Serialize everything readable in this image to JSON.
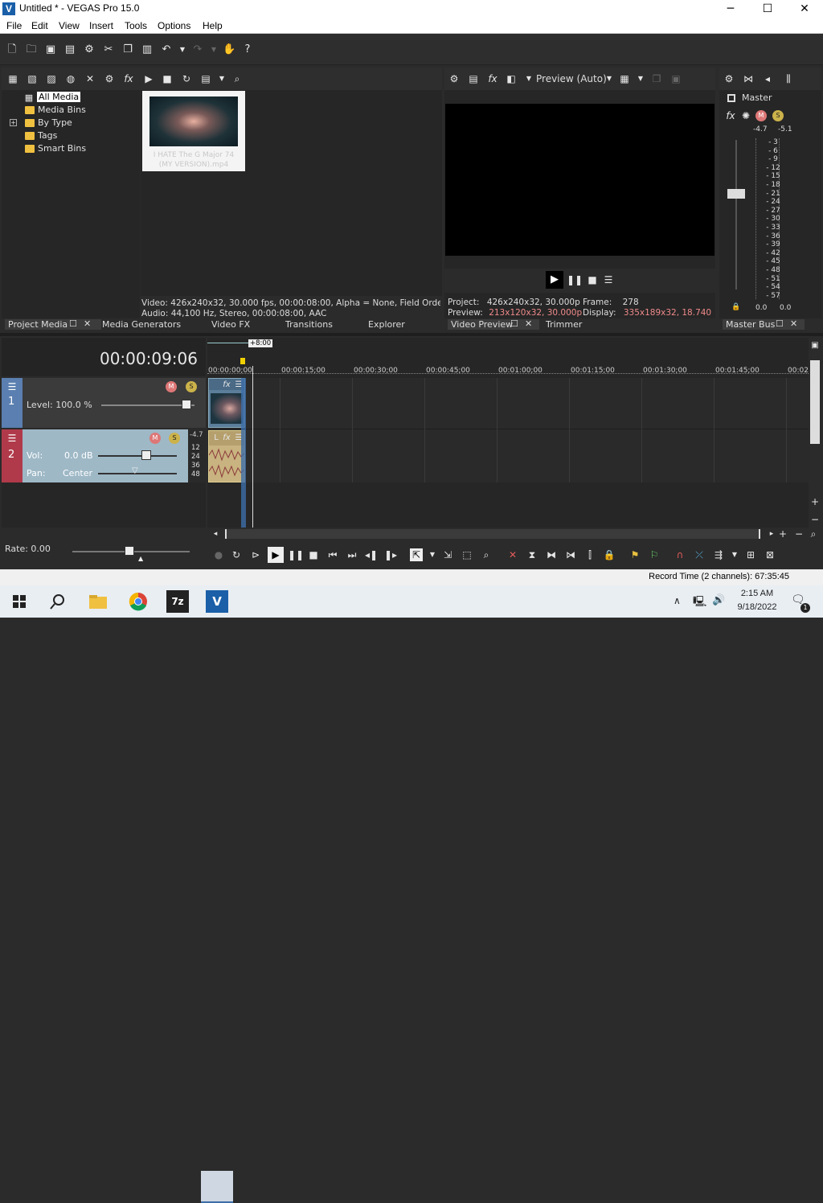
{
  "window": {
    "title": "Untitled * - VEGAS Pro 15.0",
    "app_icon": "V",
    "minimize": "─",
    "maximize": "☐",
    "close": "✕"
  },
  "menu": [
    "File",
    "Edit",
    "View",
    "Insert",
    "Tools",
    "Options",
    "Help"
  ],
  "project_media": {
    "tree": [
      {
        "label": "All Media",
        "selected": true
      },
      {
        "label": "Media Bins"
      },
      {
        "label": "By Type",
        "expander": "+"
      },
      {
        "label": "Tags"
      },
      {
        "label": "Smart Bins"
      }
    ],
    "thumbnail_caption": "I HATE The G Major 74 (MY VERSION).mp4",
    "info_video": "Video: 426x240x32, 30.000 fps, 00:00:08:00, Alpha = None, Field Order = N",
    "info_audio": "Audio: 44,100 Hz, Stereo, 00:00:08:00, AAC"
  },
  "left_tabs": [
    "Project Media",
    "Media Generators",
    "Video FX",
    "Transitions",
    "Explorer"
  ],
  "preview": {
    "mode": "Preview (Auto)",
    "project_label": "Project:",
    "project_value": "426x240x32, 30.000p",
    "preview_label": "Preview:",
    "preview_value": "213x120x32, 30.000p",
    "frame_label": "Frame:",
    "frame_value": "278",
    "display_label": "Display:",
    "display_value": "335x189x32, 18.740"
  },
  "preview_tabs": [
    "Video Preview",
    "Trimmer"
  ],
  "master": {
    "label": "Master",
    "peak_left": "-4.7",
    "peak_right": "-5.1",
    "scale": [
      "3",
      "6",
      "9",
      "12",
      "15",
      "18",
      "21",
      "24",
      "27",
      "30",
      "33",
      "36",
      "39",
      "42",
      "45",
      "48",
      "51",
      "54",
      "57"
    ],
    "bottom_left": "0.0",
    "bottom_right": "0.0",
    "tab": "Master Bus"
  },
  "timeline": {
    "timecode": "00:00:09:06",
    "cursor_flag": "+8:00",
    "ruler": [
      "00:00:00;00",
      "00:00:15;00",
      "00:00:30;00",
      "00:00:45;00",
      "00:01:00;00",
      "00:01:15;00",
      "00:01:30;00",
      "00:01:45;00",
      "00:02"
    ],
    "track1": {
      "number": "1",
      "level_label": "Level: 100.0 %"
    },
    "track2": {
      "number": "2",
      "vol_label": "Vol:",
      "vol_value": "0.0 dB",
      "pan_label": "Pan:",
      "pan_value": "Center",
      "peak": "-4.7",
      "scale": [
        "12",
        "24",
        "36",
        "48"
      ]
    },
    "rate": "Rate: 0.00",
    "record_time": "Record Time (2 channels): 67:35:45"
  },
  "taskbar": {
    "time": "2:15 AM",
    "date": "9/18/2022",
    "notification_count": "1",
    "zip_label": "7z",
    "vegas_label": "V"
  },
  "colors": {
    "track1": "#5a7fb0",
    "track2": "#b03a4a",
    "audio_clip": "#c9b380",
    "accent": "#3d6ea8"
  }
}
